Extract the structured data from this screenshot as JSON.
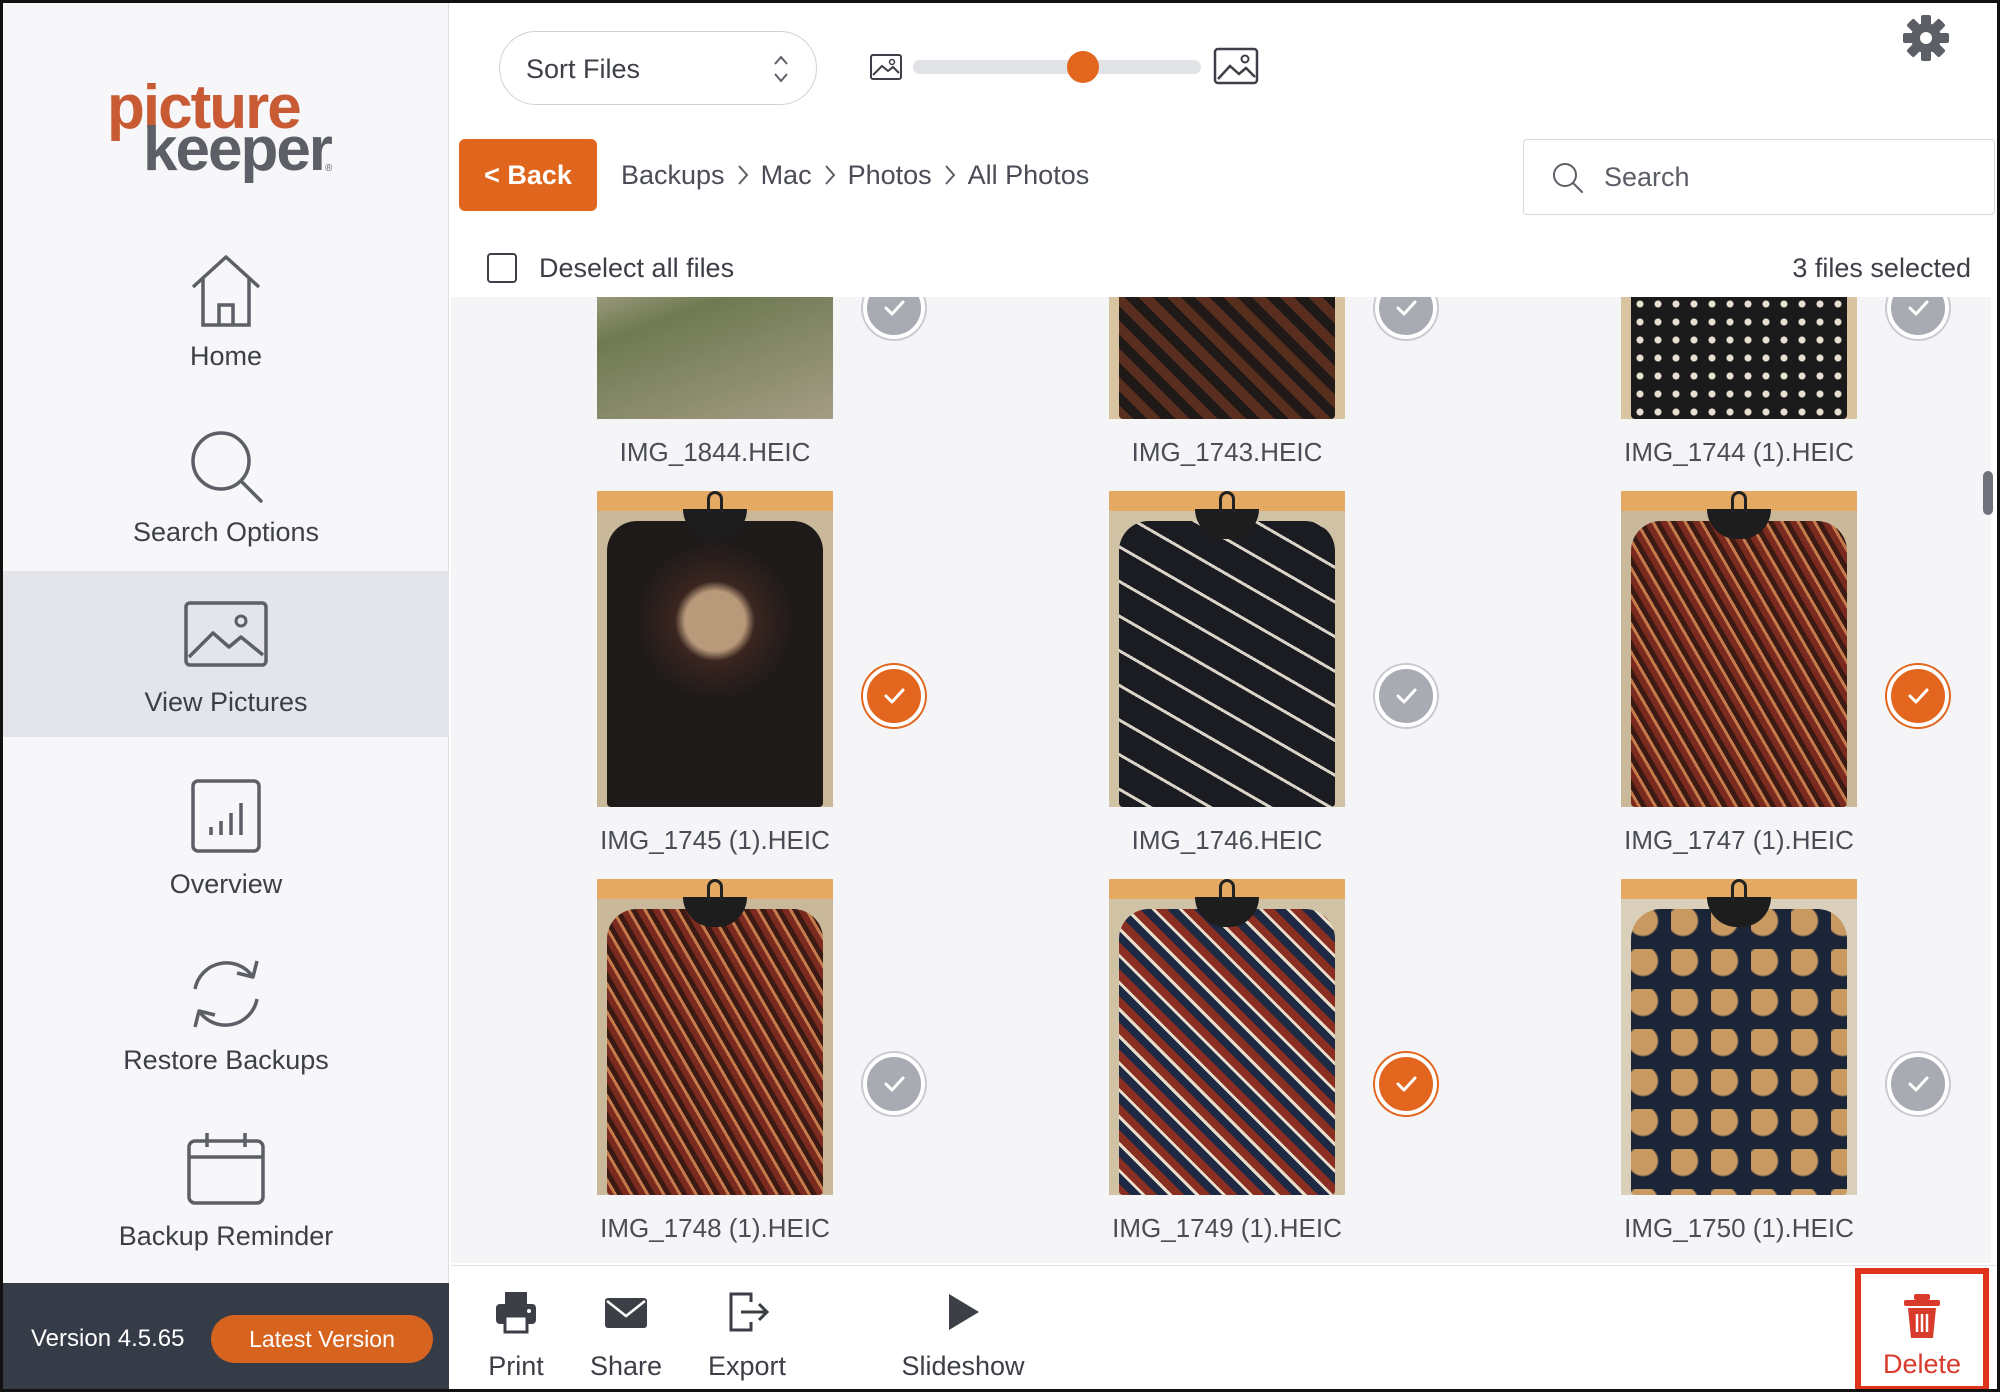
{
  "app": {
    "logo_line1": "picture",
    "logo_line2": "keeper",
    "logo_tm": "®"
  },
  "sidebar": {
    "items": [
      {
        "label": "Home",
        "icon": "home-icon"
      },
      {
        "label": "Search Options",
        "icon": "search-icon"
      },
      {
        "label": "View Pictures",
        "icon": "image-icon",
        "active": true
      },
      {
        "label": "Overview",
        "icon": "bar-chart-icon"
      },
      {
        "label": "Restore Backups",
        "icon": "refresh-icon"
      },
      {
        "label": "Backup Reminder",
        "icon": "calendar-icon"
      }
    ],
    "version": "Version 4.5.65",
    "latest_badge": "Latest Version"
  },
  "toolbar": {
    "sort_label": "Sort Files",
    "zoom_level": 0.6,
    "back_label": "< Back",
    "breadcrumb": [
      "Backups",
      "Mac",
      "Photos",
      "All Photos"
    ],
    "search_placeholder": "Search"
  },
  "selection": {
    "deselect_label": "Deselect all files",
    "count_text": "3 files selected"
  },
  "files": [
    {
      "name": "IMG_1844.HEIC",
      "selected": false,
      "style": "grass"
    },
    {
      "name": "IMG_1743.HEIC",
      "selected": false,
      "style": "checker"
    },
    {
      "name": "IMG_1744 (1).HEIC",
      "selected": false,
      "style": "dots"
    },
    {
      "name": "IMG_1745 (1).HEIC",
      "selected": true,
      "style": "dark-floral"
    },
    {
      "name": "IMG_1746.HEIC",
      "selected": false,
      "style": "black-leaf"
    },
    {
      "name": "IMG_1747 (1).HEIC",
      "selected": true,
      "style": "red-geo"
    },
    {
      "name": "IMG_1748 (1).HEIC",
      "selected": false,
      "style": "red-geo"
    },
    {
      "name": "IMG_1749 (1).HEIC",
      "selected": true,
      "style": "cube"
    },
    {
      "name": "IMG_1750 (1).HEIC",
      "selected": false,
      "style": "navy-bird"
    }
  ],
  "actions": {
    "print": "Print",
    "share": "Share",
    "export": "Export",
    "slideshow": "Slideshow",
    "delete": "Delete"
  },
  "colors": {
    "accent": "#e3661e",
    "delete": "#d83a2c",
    "sidebar_footer": "#363b48"
  }
}
